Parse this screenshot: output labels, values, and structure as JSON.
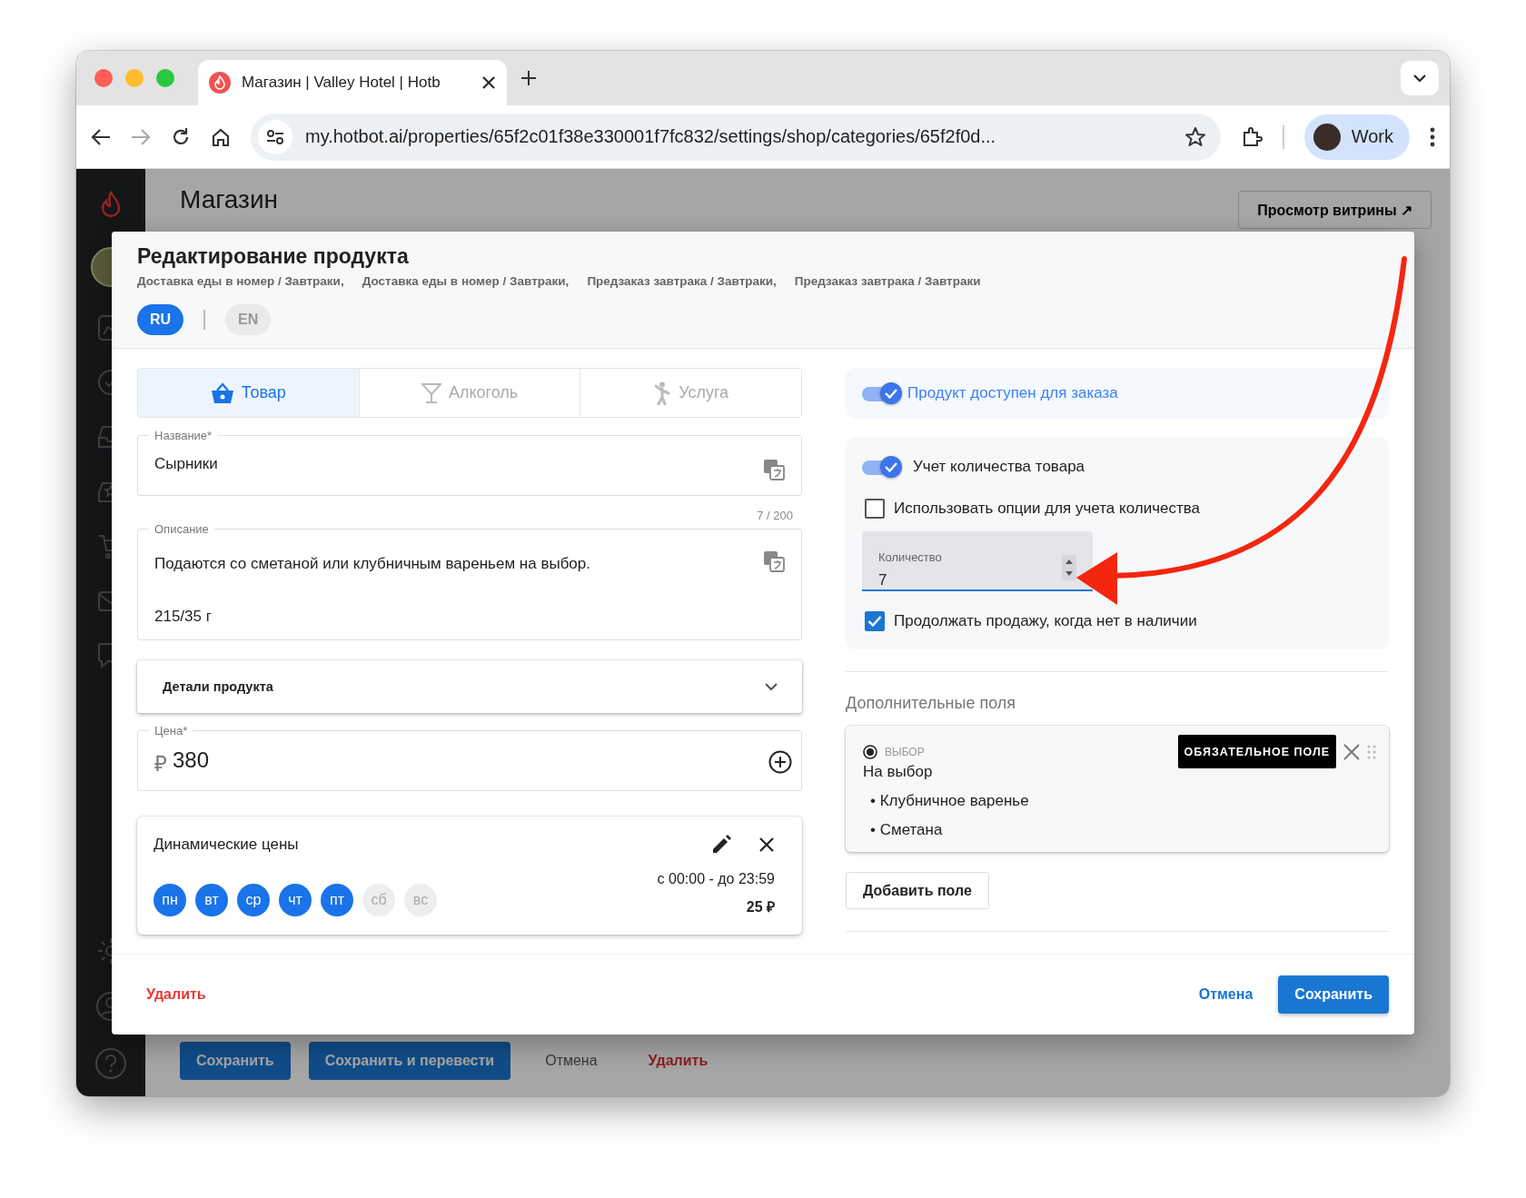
{
  "browser": {
    "tab_title": "Магазин | Valley Hotel | Hotb",
    "url": "my.hotbot.ai/properties/65f2c01f38e330001f7fc832/settings/shop/categories/65f2f0d...",
    "profile_label": "Work"
  },
  "app": {
    "header": {
      "title": "Магазин"
    },
    "storefront_button": "Просмотр витрины ↗",
    "bottom_actions": [
      {
        "label": "Сохранить",
        "kind": "primary"
      },
      {
        "label": "Сохранить и перевести",
        "kind": "primary"
      },
      {
        "label": "Отмена",
        "kind": "text"
      },
      {
        "label": "Удалить",
        "kind": "danger"
      }
    ]
  },
  "modal": {
    "title": "Редактирование продукта",
    "breadcrumbs": [
      "Доставка еды в номер / Завтраки,",
      "Доставка еды в номер / Завтраки,",
      "Предзаказ завтрака / Завтраки,",
      "Предзаказ завтрака / Завтраки"
    ],
    "languages": [
      {
        "label": "RU",
        "selected": true
      },
      {
        "label": "EN",
        "selected": false
      }
    ],
    "product_types": [
      {
        "label": "Товар",
        "kind": "goods",
        "selected": true
      },
      {
        "label": "Алкоголь",
        "kind": "alcohol",
        "selected": false
      },
      {
        "label": "Услуга",
        "kind": "service",
        "selected": false
      }
    ],
    "name_field": {
      "label": "Название*",
      "value": "Сырники"
    },
    "description_counter": "7 / 200",
    "description_field": {
      "label": "Описание",
      "lines": [
        "Подаются со сметаной или клубничным вареньем на выбор.",
        "215/35 г"
      ]
    },
    "details": {
      "label": "Детали продукта",
      "expanded": false
    },
    "price_field": {
      "label": "Цена*",
      "currency": "₽",
      "value": "380"
    },
    "dynamic_prices": {
      "title": "Динамические цены",
      "days": [
        {
          "label": "пн",
          "selected": true
        },
        {
          "label": "вт",
          "selected": true
        },
        {
          "label": "ср",
          "selected": true
        },
        {
          "label": "чт",
          "selected": true
        },
        {
          "label": "пт",
          "selected": true
        },
        {
          "label": "сб",
          "selected": false
        },
        {
          "label": "вс",
          "selected": false
        }
      ],
      "time": "с 00:00 - до 23:59",
      "price": "25 ₽"
    },
    "availability": {
      "label": "Продукт доступен для заказа",
      "on": true
    },
    "stock": {
      "tracking": {
        "label": "Учет количества товара",
        "on": true
      },
      "use_options": {
        "label": "Использовать опции для учета количества",
        "checked": false
      },
      "quantity": {
        "label": "Количество",
        "value": "7"
      },
      "continue_selling": {
        "label": "Продолжать продажу, когда нет в наличии",
        "checked": true
      }
    },
    "extra_fields": {
      "title": "Дополнительные поля",
      "items": [
        {
          "type_label": "ВЫБОР",
          "required_label": "ОБЯЗАТЕЛЬНОЕ ПОЛЕ",
          "title": "На выбор",
          "options": [
            "• Клубничное варенье",
            "• Сметана"
          ]
        }
      ],
      "add_button": "Добавить поле"
    },
    "footer": {
      "delete": "Удалить",
      "cancel": "Отмена",
      "save": "Сохранить"
    }
  }
}
